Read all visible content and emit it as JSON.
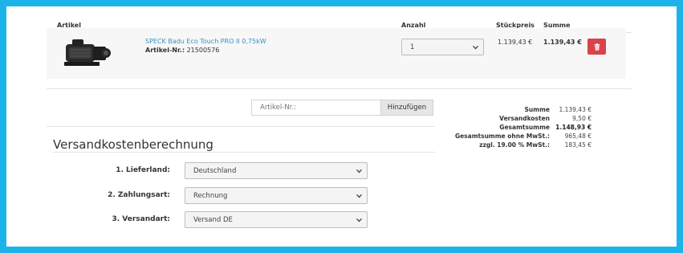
{
  "cart": {
    "headers": {
      "article": "Artikel",
      "quantity": "Anzahl",
      "unit_price": "Stückpreis",
      "total": "Summe"
    },
    "item": {
      "name": "SPECK Badu Eco Touch PRO II 0,75kW",
      "sku_label": "Artikel-Nr.:",
      "sku": "21500576",
      "quantity": "1",
      "unit_price": "1.139,43 €",
      "total": "1.139,43 €"
    }
  },
  "add_article": {
    "placeholder": "Artikel-Nr.:",
    "button_label": "Hinzufügen"
  },
  "summary": [
    {
      "label": "Summe",
      "value": "1.139,43 €",
      "bold": false
    },
    {
      "label": "Versandkosten",
      "value": "9,50 €",
      "bold": false
    },
    {
      "label": "Gesamtsumme",
      "value": "1.148,93 €",
      "bold": true
    },
    {
      "label": "Gesamtsumme ohne MwSt.:",
      "value": "965,48 €",
      "bold": false
    },
    {
      "label": "zzgl. 19.00 % MwSt.:",
      "value": "183,45 €",
      "bold": false
    }
  ],
  "shipping": {
    "title": "Versandkostenberechnung",
    "fields": [
      {
        "label": "1. Lieferland:",
        "value": "Deutschland"
      },
      {
        "label": "2. Zahlungsart:",
        "value": "Rechnung"
      },
      {
        "label": "3. Versandart:",
        "value": "Versand DE"
      }
    ]
  },
  "icons": {
    "delete": "trash-icon",
    "dropdown": "chevron-down-icon",
    "product": "pump-image"
  },
  "colors": {
    "border_frame": "#1cb4e8",
    "link": "#3a8fbf",
    "delete_button": "#d9434b"
  }
}
